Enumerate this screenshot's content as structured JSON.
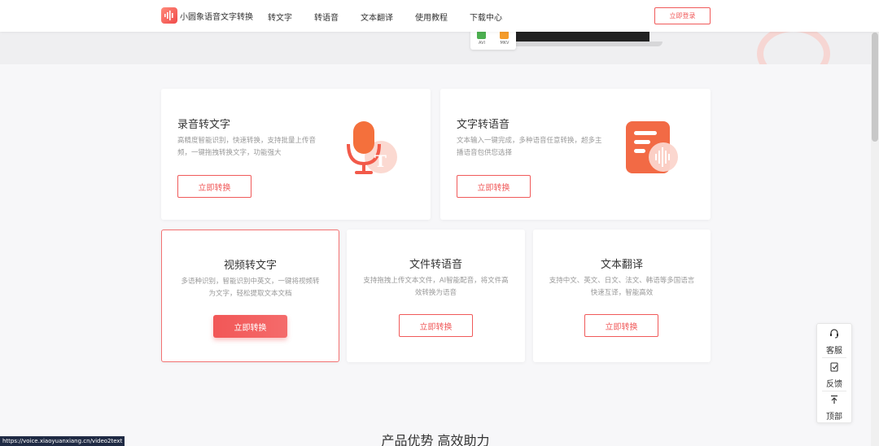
{
  "nav": {
    "logo_text": "小圆象语音文字转换",
    "menu": [
      "转文字",
      "转语音",
      "文本翻译",
      "使用教程",
      "下载中心"
    ],
    "login": "立即登录"
  },
  "hero": {
    "formats": [
      {
        "label": "AVI",
        "color": "#4caf50"
      },
      {
        "label": "MKV",
        "color": "#f59c2a"
      }
    ]
  },
  "cards_top": [
    {
      "title": "录音转文字",
      "desc": "高精度智能识别，快速转换，支持批量上传音频，一键拖拽转换文字，功能强大",
      "button": "立即转换",
      "icon": "microphone-icon"
    },
    {
      "title": "文字转语音",
      "desc": "文本输入一键完成，多种语音任意转换，超多主播语音包供您选择",
      "button": "立即转换",
      "icon": "document-audio-icon"
    }
  ],
  "cards_bottom": [
    {
      "title": "视频转文字",
      "desc": "多语种识别，智能识别中英文，一键将视频转为文字，轻松提取文本文档",
      "button": "立即转换",
      "active": true
    },
    {
      "title": "文件转语音",
      "desc": "支持拖拽上传文本文件，AI智能配音，将文件高效转换为语音",
      "button": "立即转换",
      "active": false
    },
    {
      "title": "文本翻译",
      "desc": "支持中文、英文、日文、法文、韩语等多国语言快速互译，智能高效",
      "button": "立即转换",
      "active": false
    }
  ],
  "section_title": "产品优势 高效助力",
  "side": {
    "service": "客服",
    "feedback": "反馈",
    "top": "顶部"
  },
  "status_url": "https://voice.xiaoyuanxiang.cn/video2text",
  "colors": {
    "accent": "#f05a5a",
    "accent_light": "#f8d0cc"
  }
}
